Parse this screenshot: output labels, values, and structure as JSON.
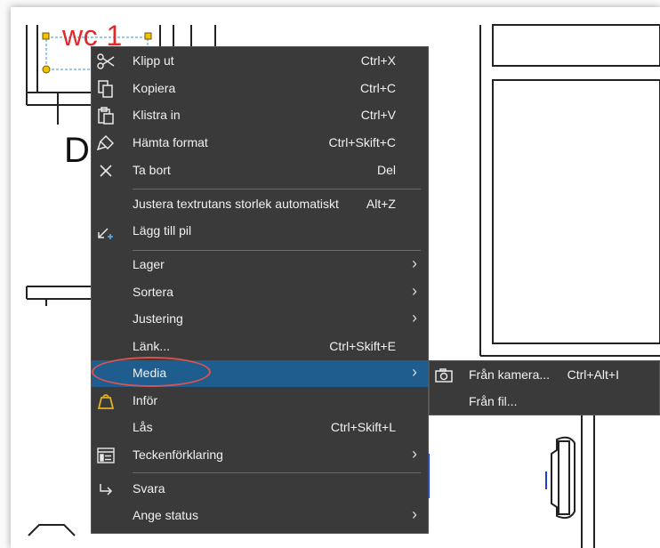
{
  "drawing": {
    "label_wc": "wc 1",
    "label_d": "D"
  },
  "context_menu": {
    "items": [
      {
        "label": "Klipp ut",
        "shortcut": "Ctrl+X",
        "icon": "scissors-icon"
      },
      {
        "label": "Kopiera",
        "shortcut": "Ctrl+C",
        "icon": "copy-icon"
      },
      {
        "label": "Klistra in",
        "shortcut": "Ctrl+V",
        "icon": "paste-icon"
      },
      {
        "label": "Hämta format",
        "shortcut": "Ctrl+Skift+C",
        "icon": "format-painter-icon"
      },
      {
        "label": "Ta bort",
        "shortcut": "Del",
        "icon": "close-icon"
      },
      {
        "label": "Justera textrutans storlek automatiskt",
        "shortcut": "Alt+Z"
      },
      {
        "label": "Lägg till pil",
        "shortcut": "",
        "icon": "add-arrow-icon"
      },
      {
        "label": "Lager",
        "shortcut": "",
        "submenu": true
      },
      {
        "label": "Sortera",
        "shortcut": "",
        "submenu": true
      },
      {
        "label": "Justering",
        "shortcut": "",
        "submenu": true
      },
      {
        "label": "Länk...",
        "shortcut": "Ctrl+Skift+E"
      },
      {
        "label": "Media",
        "shortcut": "",
        "submenu": true,
        "highlighted": true
      },
      {
        "label": "Inför",
        "shortcut": "",
        "icon": "weight-icon"
      },
      {
        "label": "Lås",
        "shortcut": "Ctrl+Skift+L"
      },
      {
        "label": "Teckenförklaring",
        "shortcut": "",
        "icon": "legend-icon",
        "submenu": true
      },
      {
        "label": "Svara",
        "shortcut": "",
        "icon": "reply-icon"
      },
      {
        "label": "Ange status",
        "shortcut": "",
        "submenu": true
      }
    ]
  },
  "media_submenu": {
    "items": [
      {
        "label": "Från kamera...",
        "shortcut": "Ctrl+Alt+I",
        "icon": "camera-icon"
      },
      {
        "label": "Från fil...",
        "shortcut": ""
      }
    ]
  },
  "colors": {
    "menu_bg": "#3a3a3a",
    "highlight": "#1e5d8e",
    "annotation": "#e02a2a",
    "inför_icon": "#e3b021"
  }
}
